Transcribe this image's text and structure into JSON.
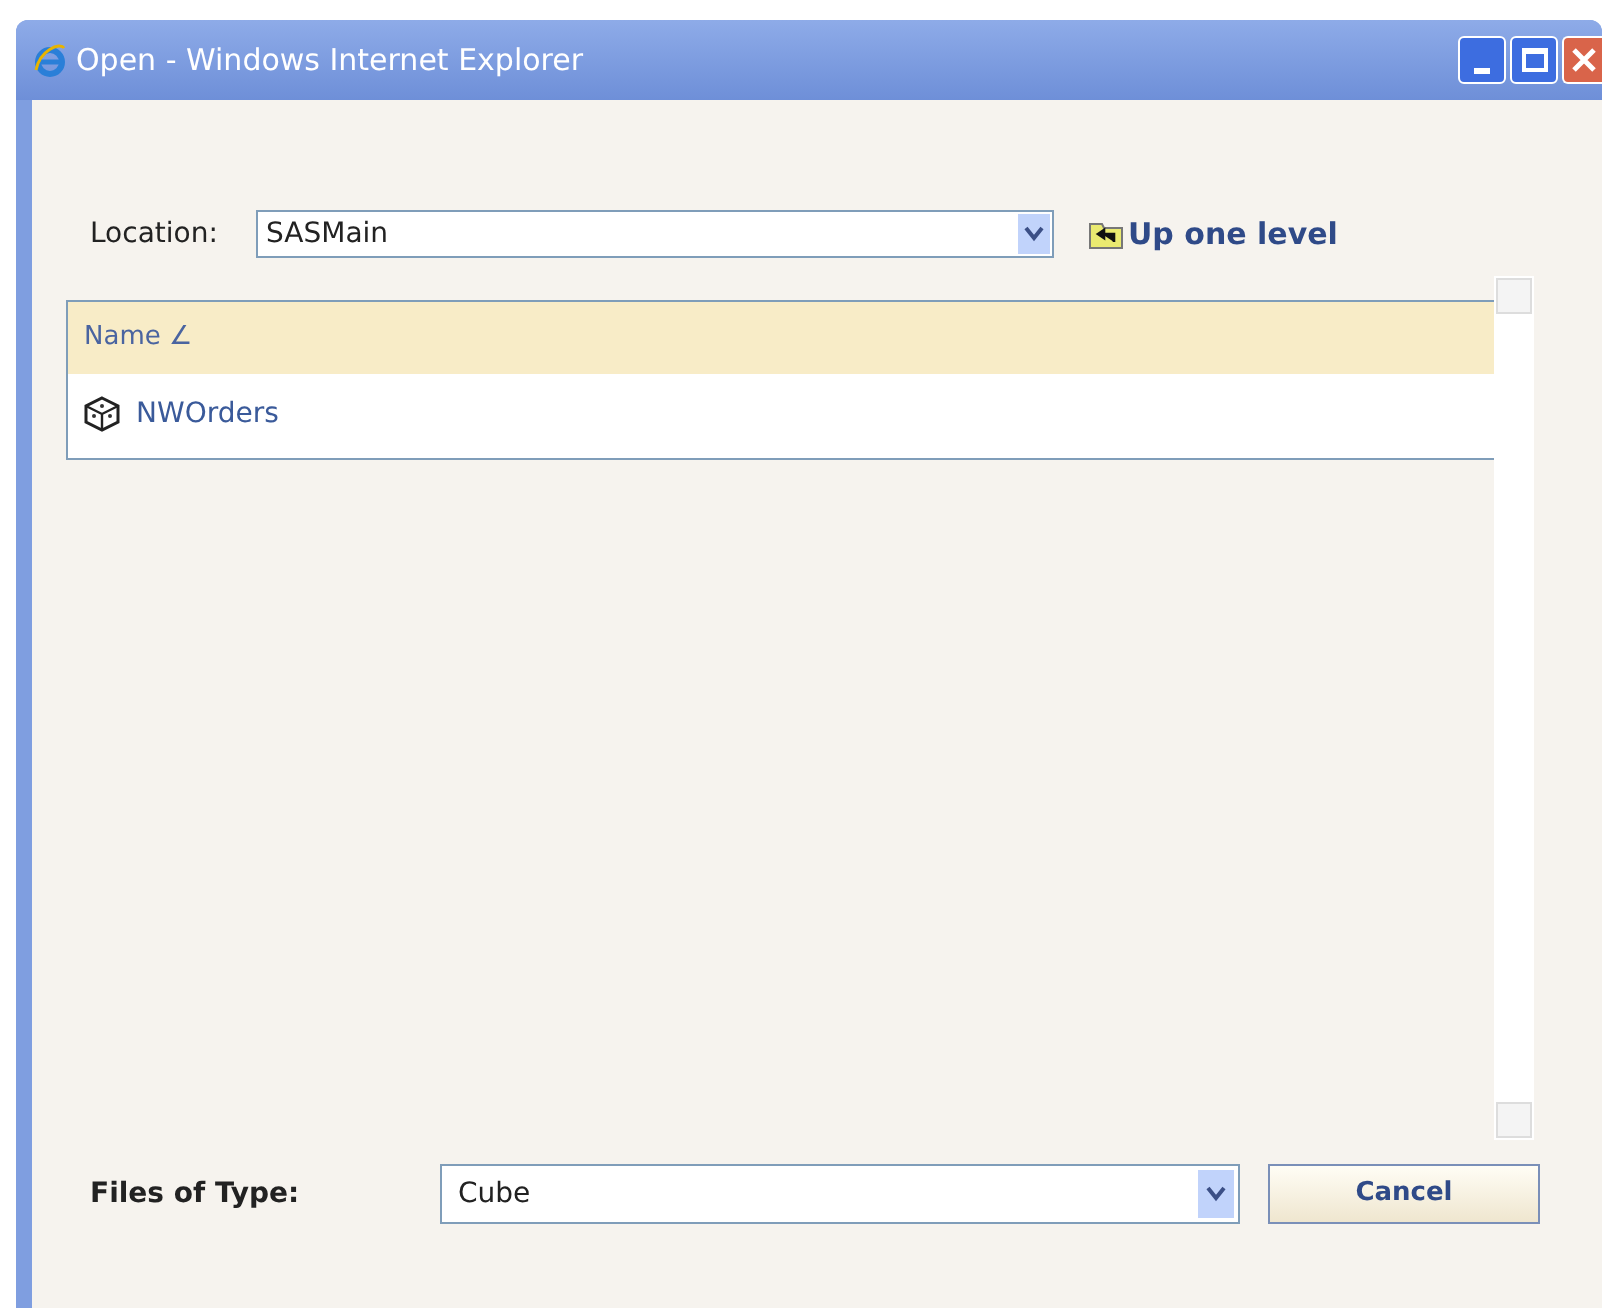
{
  "window": {
    "title": "Open - Windows Internet Explorer"
  },
  "location": {
    "label": "Location:",
    "value": "SASMain"
  },
  "up_link": {
    "label": "Up one level"
  },
  "list": {
    "columns": [
      {
        "label": "Name",
        "sort_mark": "∠"
      }
    ],
    "rows": [
      {
        "name": "NWOrders",
        "selected": false
      }
    ]
  },
  "file_type": {
    "label": "Files of Type:",
    "value": "Cube"
  },
  "buttons": [
    {
      "label": "Cancel"
    }
  ]
}
